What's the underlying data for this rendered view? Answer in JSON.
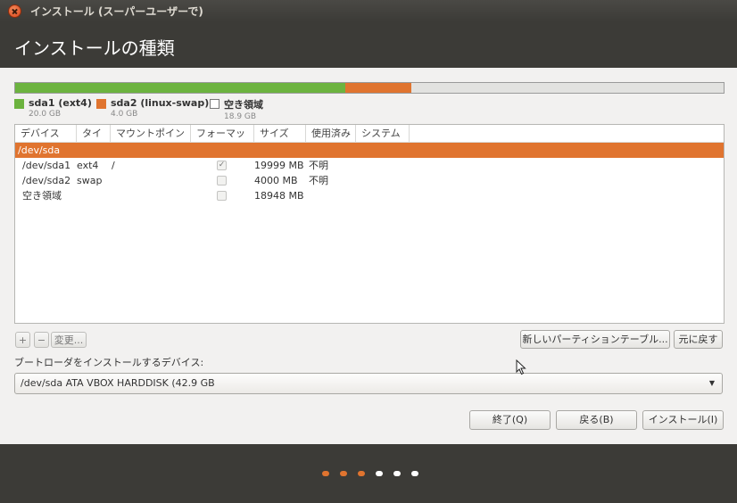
{
  "window": {
    "title": "インストール (スーパーユーザーで)",
    "page_title": "インストールの種類"
  },
  "partition_bar": {
    "segments": [
      {
        "name": "sda1 (ext4)",
        "size": "20.0 GB",
        "fraction": 0.466,
        "color": "#6cb33f"
      },
      {
        "name": "sda2 (linux-swap)",
        "size": "4.0 GB",
        "fraction": 0.093,
        "color": "#e0742f"
      },
      {
        "name": "空き領域",
        "size": "18.9 GB",
        "fraction": 0.441,
        "color": "#e2e2e0"
      }
    ]
  },
  "table": {
    "headers": [
      "デバイス",
      "タイプ",
      "マウントポイント",
      "フォーマット",
      "サイズ",
      "使用済み",
      "システム"
    ],
    "rows": [
      {
        "device": "/dev/sda",
        "type": "",
        "mount": "",
        "format": "",
        "size": "",
        "used": "",
        "system": "",
        "selected": true,
        "format_checked": false,
        "show_checkbox": false
      },
      {
        "device": "/dev/sda1",
        "type": "ext4",
        "mount": "/",
        "format": "",
        "size": "19999 MB",
        "used": "不明",
        "system": "",
        "selected": false,
        "format_checked": true,
        "show_checkbox": true
      },
      {
        "device": "/dev/sda2",
        "type": "swap",
        "mount": "",
        "format": "",
        "size": "4000 MB",
        "used": "不明",
        "system": "",
        "selected": false,
        "format_checked": false,
        "show_checkbox": true
      },
      {
        "device": "空き領域",
        "type": "",
        "mount": "",
        "format": "",
        "size": "18948 MB",
        "used": "",
        "system": "",
        "selected": false,
        "format_checked": false,
        "show_checkbox": true
      }
    ]
  },
  "table_buttons": {
    "add": "+",
    "remove": "−",
    "change": "変更...",
    "new_table": "新しいパーティションテーブル...",
    "revert": "元に戻す"
  },
  "bootloader": {
    "label": "ブートローダをインストールするデバイス:",
    "selected": "/dev/sda   ATA VBOX HARDDISK (42.9 GB"
  },
  "actions": {
    "quit": "終了(Q)",
    "back": "戻る(B)",
    "install": "インストール(I)"
  },
  "progress": {
    "total_steps": 6,
    "current_step": 3,
    "active_color": "#e0742f",
    "inactive_color": "#ffffff"
  }
}
